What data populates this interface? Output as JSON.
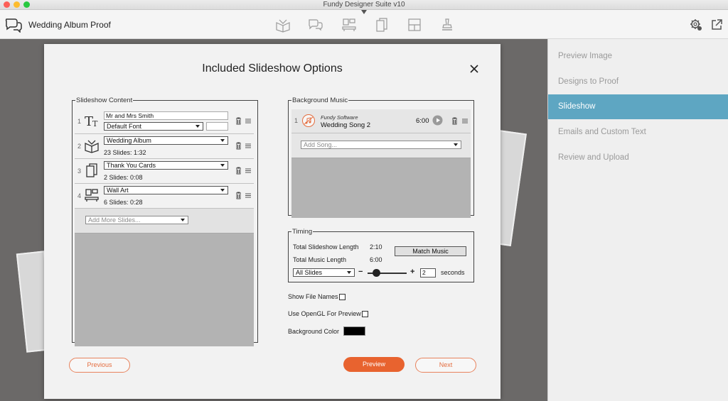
{
  "window": {
    "title": "Fundy Designer Suite v10"
  },
  "toolbar": {
    "project_title": "Wedding Album Proof",
    "tools": [
      "album-tool",
      "proof-tool",
      "wall-art-tool",
      "cards-tool",
      "layout-tool",
      "stamp-tool"
    ]
  },
  "sidebar": {
    "items": [
      {
        "label": "Preview Image",
        "active": false
      },
      {
        "label": "Designs to Proof",
        "active": false
      },
      {
        "label": "Slideshow",
        "active": true
      },
      {
        "label": "Emails and Custom Text",
        "active": false
      },
      {
        "label": "Review and Upload",
        "active": false
      }
    ]
  },
  "dialog": {
    "title": "Included Slideshow Options",
    "slideshow_content": {
      "legend": "Slideshow Content",
      "rows": [
        {
          "num": "1",
          "title_value": "Mr and Mrs Smith",
          "font_select": "Default Font"
        },
        {
          "num": "2",
          "select": "Wedding Album",
          "sub": "23 Slides: 1:32"
        },
        {
          "num": "3",
          "select": "Thank You Cards",
          "sub": "2 Slides: 0:08"
        },
        {
          "num": "4",
          "select": "Wall Art",
          "sub": "6 Slides: 0:28"
        }
      ],
      "add_more_placeholder": "Add More Slides..."
    },
    "background_music": {
      "legend": "Background Music",
      "song": {
        "num": "1",
        "artist": "Fundy Software",
        "title": "Wedding Song 2",
        "duration": "6:00"
      },
      "add_song_placeholder": "Add Song..."
    },
    "timing": {
      "legend": "Timing",
      "slideshow_length_label": "Total Slideshow Length",
      "slideshow_length_value": "2:10",
      "music_length_label": "Total Music Length",
      "music_length_value": "6:00",
      "match_music_label": "Match Music",
      "scope_select": "All Slides",
      "minus": "−",
      "plus": "+",
      "seconds_value": "2",
      "seconds_label": "seconds"
    },
    "options": {
      "show_file_names": "Show File Names",
      "use_opengl": "Use OpenGL For Preview",
      "background_color": "Background Color",
      "background_color_value": "#000000"
    },
    "buttons": {
      "previous": "Previous",
      "preview": "Preview",
      "next": "Next"
    }
  },
  "colors": {
    "accent": "#e8632f",
    "sidebar_active": "#5ea6c2"
  }
}
